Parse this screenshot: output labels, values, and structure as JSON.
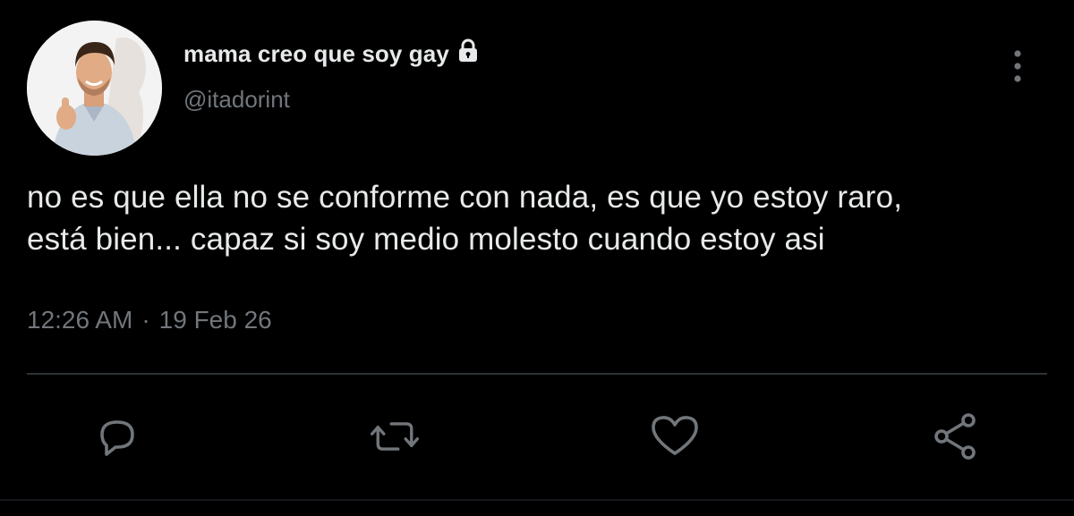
{
  "author": {
    "display_name": "mama creo que soy gay",
    "handle": "@itadorint",
    "protected_icon": "lock-icon",
    "avatar": "profile-photo-man-thumbs-up"
  },
  "tweet": {
    "text_lines": [
      "no es que ella no se conforme con nada, es que yo estoy raro,",
      "está bien... capaz si soy medio molesto cuando estoy asi"
    ],
    "time": "12:26 AM",
    "separator": "·",
    "date": "19 Feb 26"
  },
  "actions": {
    "reply_icon": "reply-icon",
    "retweet_icon": "retweet-icon",
    "like_icon": "heart-icon",
    "share_icon": "share-icon",
    "more_icon": "more-vertical-icon"
  },
  "colors": {
    "background": "#000000",
    "primary_text": "#e7e9ea",
    "secondary_text": "#71767b",
    "divider": "#2f3336"
  }
}
